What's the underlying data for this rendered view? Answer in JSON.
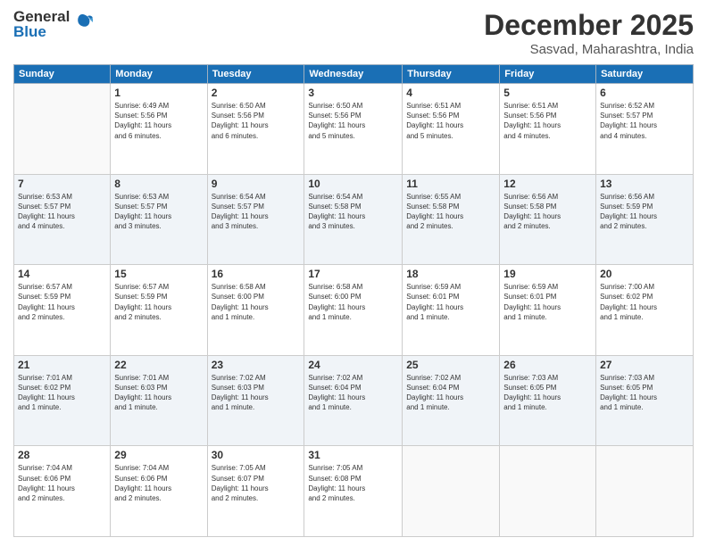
{
  "logo": {
    "general": "General",
    "blue": "Blue"
  },
  "header": {
    "month": "December 2025",
    "location": "Sasvad, Maharashtra, India"
  },
  "weekdays": [
    "Sunday",
    "Monday",
    "Tuesday",
    "Wednesday",
    "Thursday",
    "Friday",
    "Saturday"
  ],
  "weeks": [
    [
      {
        "day": "",
        "info": ""
      },
      {
        "day": "1",
        "info": "Sunrise: 6:49 AM\nSunset: 5:56 PM\nDaylight: 11 hours\nand 6 minutes."
      },
      {
        "day": "2",
        "info": "Sunrise: 6:50 AM\nSunset: 5:56 PM\nDaylight: 11 hours\nand 6 minutes."
      },
      {
        "day": "3",
        "info": "Sunrise: 6:50 AM\nSunset: 5:56 PM\nDaylight: 11 hours\nand 5 minutes."
      },
      {
        "day": "4",
        "info": "Sunrise: 6:51 AM\nSunset: 5:56 PM\nDaylight: 11 hours\nand 5 minutes."
      },
      {
        "day": "5",
        "info": "Sunrise: 6:51 AM\nSunset: 5:56 PM\nDaylight: 11 hours\nand 4 minutes."
      },
      {
        "day": "6",
        "info": "Sunrise: 6:52 AM\nSunset: 5:57 PM\nDaylight: 11 hours\nand 4 minutes."
      }
    ],
    [
      {
        "day": "7",
        "info": "Sunrise: 6:53 AM\nSunset: 5:57 PM\nDaylight: 11 hours\nand 4 minutes."
      },
      {
        "day": "8",
        "info": "Sunrise: 6:53 AM\nSunset: 5:57 PM\nDaylight: 11 hours\nand 3 minutes."
      },
      {
        "day": "9",
        "info": "Sunrise: 6:54 AM\nSunset: 5:57 PM\nDaylight: 11 hours\nand 3 minutes."
      },
      {
        "day": "10",
        "info": "Sunrise: 6:54 AM\nSunset: 5:58 PM\nDaylight: 11 hours\nand 3 minutes."
      },
      {
        "day": "11",
        "info": "Sunrise: 6:55 AM\nSunset: 5:58 PM\nDaylight: 11 hours\nand 2 minutes."
      },
      {
        "day": "12",
        "info": "Sunrise: 6:56 AM\nSunset: 5:58 PM\nDaylight: 11 hours\nand 2 minutes."
      },
      {
        "day": "13",
        "info": "Sunrise: 6:56 AM\nSunset: 5:59 PM\nDaylight: 11 hours\nand 2 minutes."
      }
    ],
    [
      {
        "day": "14",
        "info": "Sunrise: 6:57 AM\nSunset: 5:59 PM\nDaylight: 11 hours\nand 2 minutes."
      },
      {
        "day": "15",
        "info": "Sunrise: 6:57 AM\nSunset: 5:59 PM\nDaylight: 11 hours\nand 2 minutes."
      },
      {
        "day": "16",
        "info": "Sunrise: 6:58 AM\nSunset: 6:00 PM\nDaylight: 11 hours\nand 1 minute."
      },
      {
        "day": "17",
        "info": "Sunrise: 6:58 AM\nSunset: 6:00 PM\nDaylight: 11 hours\nand 1 minute."
      },
      {
        "day": "18",
        "info": "Sunrise: 6:59 AM\nSunset: 6:01 PM\nDaylight: 11 hours\nand 1 minute."
      },
      {
        "day": "19",
        "info": "Sunrise: 6:59 AM\nSunset: 6:01 PM\nDaylight: 11 hours\nand 1 minute."
      },
      {
        "day": "20",
        "info": "Sunrise: 7:00 AM\nSunset: 6:02 PM\nDaylight: 11 hours\nand 1 minute."
      }
    ],
    [
      {
        "day": "21",
        "info": "Sunrise: 7:01 AM\nSunset: 6:02 PM\nDaylight: 11 hours\nand 1 minute."
      },
      {
        "day": "22",
        "info": "Sunrise: 7:01 AM\nSunset: 6:03 PM\nDaylight: 11 hours\nand 1 minute."
      },
      {
        "day": "23",
        "info": "Sunrise: 7:02 AM\nSunset: 6:03 PM\nDaylight: 11 hours\nand 1 minute."
      },
      {
        "day": "24",
        "info": "Sunrise: 7:02 AM\nSunset: 6:04 PM\nDaylight: 11 hours\nand 1 minute."
      },
      {
        "day": "25",
        "info": "Sunrise: 7:02 AM\nSunset: 6:04 PM\nDaylight: 11 hours\nand 1 minute."
      },
      {
        "day": "26",
        "info": "Sunrise: 7:03 AM\nSunset: 6:05 PM\nDaylight: 11 hours\nand 1 minute."
      },
      {
        "day": "27",
        "info": "Sunrise: 7:03 AM\nSunset: 6:05 PM\nDaylight: 11 hours\nand 1 minute."
      }
    ],
    [
      {
        "day": "28",
        "info": "Sunrise: 7:04 AM\nSunset: 6:06 PM\nDaylight: 11 hours\nand 2 minutes."
      },
      {
        "day": "29",
        "info": "Sunrise: 7:04 AM\nSunset: 6:06 PM\nDaylight: 11 hours\nand 2 minutes."
      },
      {
        "day": "30",
        "info": "Sunrise: 7:05 AM\nSunset: 6:07 PM\nDaylight: 11 hours\nand 2 minutes."
      },
      {
        "day": "31",
        "info": "Sunrise: 7:05 AM\nSunset: 6:08 PM\nDaylight: 11 hours\nand 2 minutes."
      },
      {
        "day": "",
        "info": ""
      },
      {
        "day": "",
        "info": ""
      },
      {
        "day": "",
        "info": ""
      }
    ]
  ]
}
